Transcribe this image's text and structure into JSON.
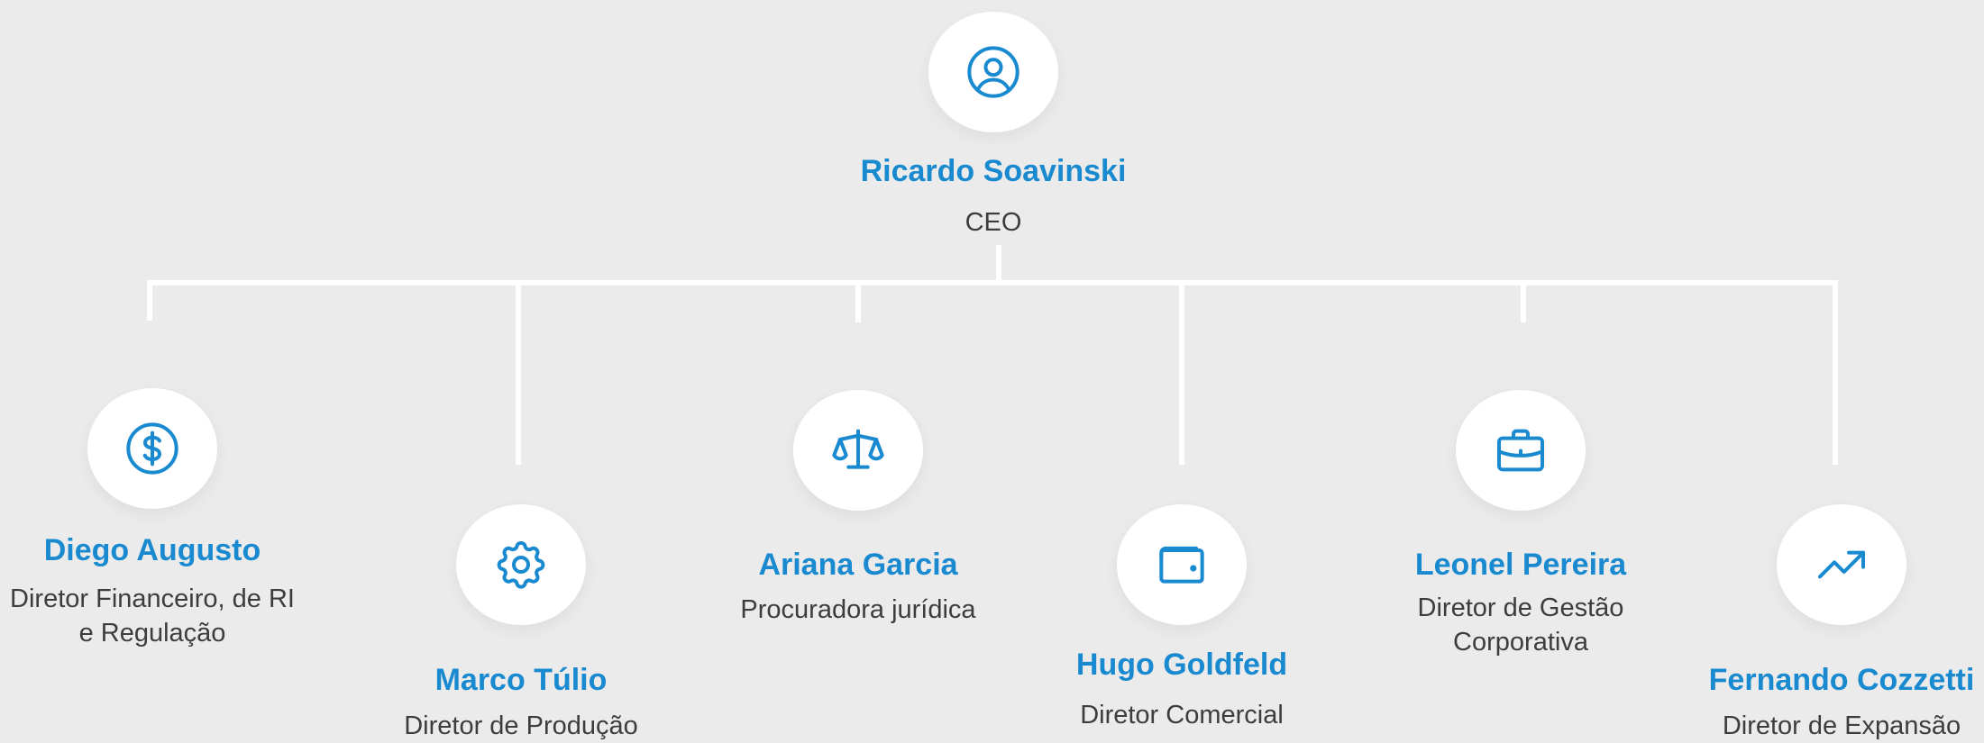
{
  "chart": {
    "ceo": {
      "name": "Ricardo Soavinski",
      "role": "CEO",
      "icon": "user-icon"
    },
    "directors": [
      {
        "name": "Diego Augusto",
        "role": "Diretor Financeiro, de RI e Regulação",
        "icon": "dollar-icon"
      },
      {
        "name": "Marco Túlio",
        "role": "Diretor de Produção",
        "icon": "gear-icon"
      },
      {
        "name": "Ariana Garcia",
        "role": "Procuradora jurídica",
        "icon": "scale-icon"
      },
      {
        "name": "Hugo Goldfeld",
        "role": "Diretor Comercial",
        "icon": "wallet-icon"
      },
      {
        "name": "Leonel Pereira",
        "role": "Diretor de Gestão Corporativa",
        "icon": "briefcase-icon"
      },
      {
        "name": "Fernando Cozzetti",
        "role": "Diretor de Expansão",
        "icon": "trending-up-icon"
      }
    ]
  },
  "colors": {
    "background": "#ebebeb",
    "accent": "#1a8ad0",
    "connector": "#ffffff",
    "text": "#3d3d3d"
  }
}
